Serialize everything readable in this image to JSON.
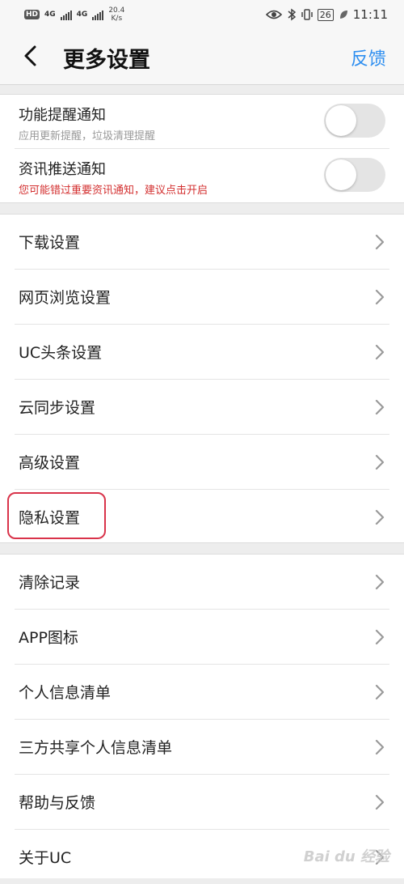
{
  "status_bar": {
    "hd": "HD",
    "net1": "4G",
    "net2": "4G",
    "speed_value": "20.4",
    "speed_unit": "K/s",
    "battery": "26",
    "time": "11:11"
  },
  "header": {
    "title": "更多设置",
    "feedback_label": "反馈"
  },
  "notifications": [
    {
      "title": "功能提醒通知",
      "subtitle": "应用更新提醒，垃圾清理提醒",
      "on": false
    },
    {
      "title": "资讯推送通知",
      "subtitle": "您可能错过重要资讯通知，建议点击开启",
      "on": false
    }
  ],
  "group1": [
    {
      "label": "下载设置"
    },
    {
      "label": "网页浏览设置"
    },
    {
      "label": "UC头条设置"
    },
    {
      "label": "云同步设置"
    },
    {
      "label": "高级设置"
    },
    {
      "label": "隐私设置"
    }
  ],
  "group2": [
    {
      "label": "清除记录"
    },
    {
      "label": "APP图标"
    },
    {
      "label": "个人信息清单"
    },
    {
      "label": "三方共享个人信息清单"
    },
    {
      "label": "帮助与反馈"
    },
    {
      "label": "关于UC"
    }
  ],
  "colors": {
    "accent": "#2f8ff0",
    "warning": "#d32f2f",
    "highlight": "#d9334a"
  },
  "watermark": "Bai du 经验"
}
